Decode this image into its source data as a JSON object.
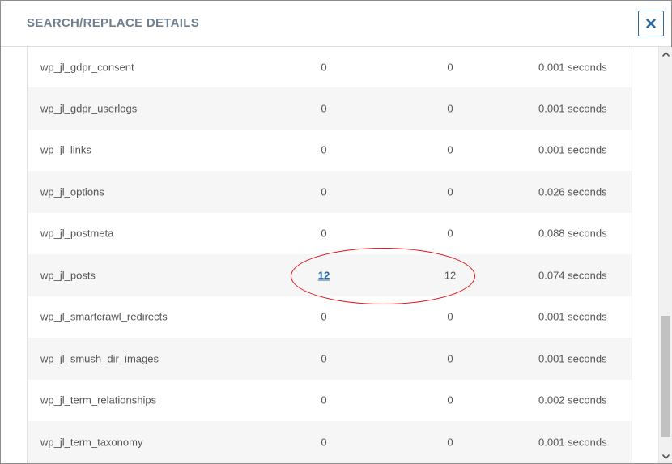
{
  "modal": {
    "title": "SEARCH/REPLACE DETAILS",
    "close_icon": "close-x-icon",
    "accent_color": "#2f6a9d",
    "highlight_color": "#e0141a"
  },
  "table": {
    "rows": [
      {
        "name": "wp_jl_gdpr_consent",
        "changes": "0",
        "updates": "0",
        "time": "0.001 seconds"
      },
      {
        "name": "wp_jl_gdpr_userlogs",
        "changes": "0",
        "updates": "0",
        "time": "0.001 seconds"
      },
      {
        "name": "wp_jl_links",
        "changes": "0",
        "updates": "0",
        "time": "0.001 seconds"
      },
      {
        "name": "wp_jl_options",
        "changes": "0",
        "updates": "0",
        "time": "0.026 seconds"
      },
      {
        "name": "wp_jl_postmeta",
        "changes": "0",
        "updates": "0",
        "time": "0.088 seconds"
      },
      {
        "name": "wp_jl_posts",
        "changes": "12",
        "updates": "12",
        "time": "0.074 seconds",
        "changes_link": true
      },
      {
        "name": "wp_jl_smartcrawl_redirects",
        "changes": "0",
        "updates": "0",
        "time": "0.001 seconds"
      },
      {
        "name": "wp_jl_smush_dir_images",
        "changes": "0",
        "updates": "0",
        "time": "0.001 seconds"
      },
      {
        "name": "wp_jl_term_relationships",
        "changes": "0",
        "updates": "0",
        "time": "0.002 seconds"
      },
      {
        "name": "wp_jl_term_taxonomy",
        "changes": "0",
        "updates": "0",
        "time": "0.001 seconds"
      }
    ]
  },
  "scrollbar": {
    "up_icon": "scroll-up-arrow-icon",
    "down_icon": "scroll-down-arrow-icon"
  }
}
